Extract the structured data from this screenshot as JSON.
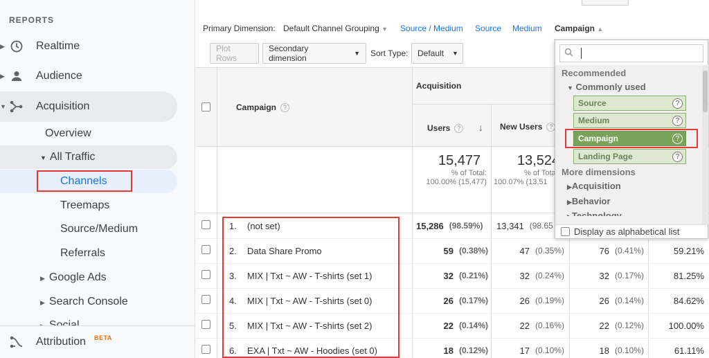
{
  "sidebar": {
    "reports_label": "REPORTS",
    "items": [
      {
        "label": "Realtime"
      },
      {
        "label": "Audience"
      },
      {
        "label": "Acquisition"
      }
    ],
    "acquisition_children": {
      "overview": "Overview",
      "all_traffic": "All Traffic",
      "all_traffic_children": [
        "Channels",
        "Treemaps",
        "Source/Medium",
        "Referrals"
      ],
      "google_ads": "Google Ads",
      "search_console": "Search Console",
      "social": "Social"
    },
    "attribution": "Attribution",
    "beta_badge": "BETA"
  },
  "primary_dimension": {
    "label": "Primary Dimension:",
    "current": "Default Channel Grouping",
    "links": [
      "Source / Medium",
      "Source",
      "Medium"
    ],
    "campaign": "Campaign"
  },
  "toolbar": {
    "plot_rows": "Plot Rows",
    "secondary_dimension": "Secondary dimension",
    "sort_type_label": "Sort Type:",
    "sort_type_value": "Default"
  },
  "table": {
    "acquisition_header": "Acquisition",
    "campaign_header": "Campaign",
    "users_header": "Users",
    "new_users_header": "New Users",
    "totals": {
      "users": "15,477",
      "users_pct": "% of Total:",
      "users_pct_value": "100.00% (15,477)",
      "new_users": "13,524",
      "new_users_pct": "% of Tota",
      "new_users_pct_value": "100.07% (13,51"
    },
    "rows": [
      {
        "idx": "1.",
        "campaign": "(not set)",
        "users": "15,286",
        "users_pct": "(98.59%)",
        "new_users": "13,341",
        "new_users_pct": "(98.65",
        "sessions": "",
        "sessions_pct": "",
        "rate": ""
      },
      {
        "idx": "2.",
        "campaign": "Data Share Promo",
        "users": "59",
        "users_pct": "(0.38%)",
        "new_users": "47",
        "new_users_pct": "(0.35%)",
        "sessions": "76",
        "sessions_pct": "(0.41%)",
        "rate": "59.21%"
      },
      {
        "idx": "3.",
        "campaign": "MIX | Txt ~ AW - T-shirts (set 1)",
        "users": "32",
        "users_pct": "(0.21%)",
        "new_users": "32",
        "new_users_pct": "(0.24%)",
        "sessions": "32",
        "sessions_pct": "(0.17%)",
        "rate": "81.25%"
      },
      {
        "idx": "4.",
        "campaign": "MIX | Txt ~ AW - T-shirts (set 0)",
        "users": "26",
        "users_pct": "(0.17%)",
        "new_users": "26",
        "new_users_pct": "(0.19%)",
        "sessions": "26",
        "sessions_pct": "(0.14%)",
        "rate": "84.62%"
      },
      {
        "idx": "5.",
        "campaign": "MIX | Txt ~ AW - T-shirts (set 2)",
        "users": "22",
        "users_pct": "(0.14%)",
        "new_users": "22",
        "new_users_pct": "(0.16%)",
        "sessions": "22",
        "sessions_pct": "(0.12%)",
        "rate": "100.00%"
      },
      {
        "idx": "6.",
        "campaign": "EXA | Txt ~ AW - Hoodies (set 0)",
        "users": "18",
        "users_pct": "(0.12%)",
        "new_users": "17",
        "new_users_pct": "(0.10%)",
        "sessions": "18",
        "sessions_pct": "(0.10%)",
        "rate": "61.11%"
      }
    ]
  },
  "dropdown": {
    "search_placeholder": "",
    "recommended": "Recommended",
    "commonly_used": "Commonly used",
    "items": [
      "Source",
      "Medium",
      "Campaign",
      "Landing Page"
    ],
    "selected": "Campaign",
    "more_dimensions": "More dimensions",
    "groups": [
      "Acquisition",
      "Behavior",
      "Technology"
    ],
    "footer": "Display as alphabetical list"
  },
  "colors": {
    "accent_red": "#e53935",
    "link_blue": "#1a73e8",
    "selected_green": "#7aa35a"
  }
}
